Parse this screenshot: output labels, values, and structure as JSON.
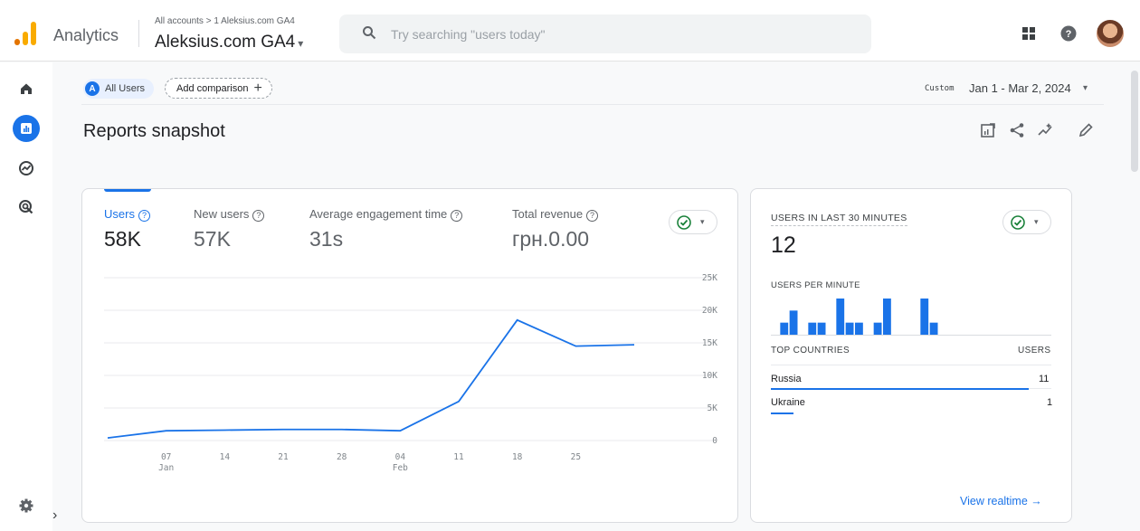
{
  "header": {
    "app_name": "Analytics",
    "account_path": "All accounts > 1 Aleksius.com GA4",
    "property_name": "Aleksius.com GA4",
    "search_placeholder": "Try searching \"users today\"",
    "icons": [
      "analytics-logo-icon",
      "search-icon",
      "apps-grid-icon",
      "help-icon",
      "avatar"
    ]
  },
  "sidebar": {
    "items": [
      {
        "name": "home",
        "icon": "home-icon",
        "active": false
      },
      {
        "name": "reports",
        "icon": "reports-icon",
        "active": true
      },
      {
        "name": "explore",
        "icon": "explore-icon",
        "active": false
      },
      {
        "name": "advertising",
        "icon": "advertising-icon",
        "active": false
      }
    ],
    "settings_icon": "gear-icon",
    "expand_label": "›"
  },
  "comparison": {
    "segment_badge": "A",
    "segment_label": "All Users",
    "add_label": "Add comparison",
    "add_plus": "+"
  },
  "date": {
    "label": "Custom",
    "range": "Jan 1 - Mar 2, 2024",
    "caret": "▾"
  },
  "page": {
    "title": "Reports snapshot",
    "tools": [
      "customize-report-icon",
      "share-icon",
      "insights-icon",
      "edit-icon"
    ]
  },
  "metrics": [
    {
      "label": "Users",
      "value": "58K",
      "active": true
    },
    {
      "label": "New users",
      "value": "57K",
      "active": false
    },
    {
      "label": "Average engagement time",
      "value": "31s",
      "active": false
    },
    {
      "label": "Total revenue",
      "value": "грн.0.00",
      "active": false
    }
  ],
  "colors": {
    "accent": "#1a73e8",
    "ok_green": "#188038",
    "logo_orange": "#f9ab00",
    "logo_dark": "#e37400"
  },
  "chart_data": {
    "type": "line",
    "title": "",
    "series": [
      {
        "values": [
          400,
          1500,
          1600,
          1700,
          1700,
          1500,
          6000,
          18500,
          14500,
          14700
        ]
      }
    ],
    "x": [
      0,
      1,
      2,
      3,
      4,
      5,
      6,
      7,
      8,
      9
    ],
    "x_ticks": [
      {
        "index": 1,
        "label": "07",
        "sub": "Jan"
      },
      {
        "index": 2,
        "label": "14",
        "sub": ""
      },
      {
        "index": 3,
        "label": "21",
        "sub": ""
      },
      {
        "index": 4,
        "label": "28",
        "sub": ""
      },
      {
        "index": 5,
        "label": "04",
        "sub": "Feb"
      },
      {
        "index": 6,
        "label": "11",
        "sub": ""
      },
      {
        "index": 7,
        "label": "18",
        "sub": ""
      },
      {
        "index": 8,
        "label": "25",
        "sub": ""
      }
    ],
    "y_ticks": [
      "0",
      "5K",
      "10K",
      "15K",
      "20K",
      "25K"
    ],
    "ylim": [
      0,
      25000
    ],
    "grid": true
  },
  "realtime": {
    "title": "USERS IN LAST 30 MINUTES",
    "value": "12",
    "per_minute_label": "USERS PER MINUTE",
    "per_minute": [
      0,
      1,
      2,
      0,
      1,
      1,
      0,
      3,
      1,
      1,
      0,
      1,
      3,
      0,
      0,
      0,
      3,
      1,
      0,
      0,
      0,
      0,
      0,
      0,
      0,
      0,
      0,
      0,
      0,
      0
    ],
    "countries_header": "TOP COUNTRIES",
    "users_header": "USERS",
    "countries": [
      {
        "name": "Russia",
        "value": "11",
        "share": 0.92
      },
      {
        "name": "Ukraine",
        "value": "1",
        "share": 0.08
      }
    ],
    "link_label": "View realtime",
    "link_arrow": "→"
  }
}
